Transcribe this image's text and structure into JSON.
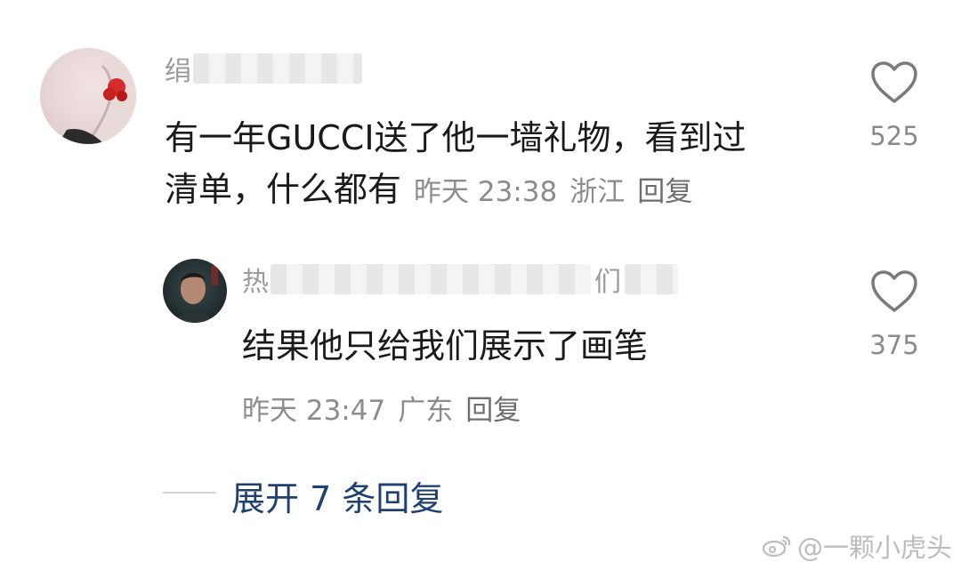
{
  "comments": [
    {
      "username_visible": "绢",
      "text_line1": "有一年GUCCI送了他一墙礼物，看到过",
      "text_line2": "清单，什么都有",
      "time": "昨天 23:38",
      "location": "浙江",
      "reply_label": "回复",
      "likes": "525"
    },
    {
      "username_visible": "热",
      "username_tail": "们",
      "text": "结果他只给我们展示了画笔",
      "time": "昨天 23:47",
      "location": "广东",
      "reply_label": "回复",
      "likes": "375"
    }
  ],
  "expand_replies": "展开 7 条回复",
  "watermark": "@一颗小虎头",
  "colors": {
    "link_blue": "#1f4170",
    "meta_gray": "#8c8c8c",
    "text_dark": "#1a1a1a"
  }
}
